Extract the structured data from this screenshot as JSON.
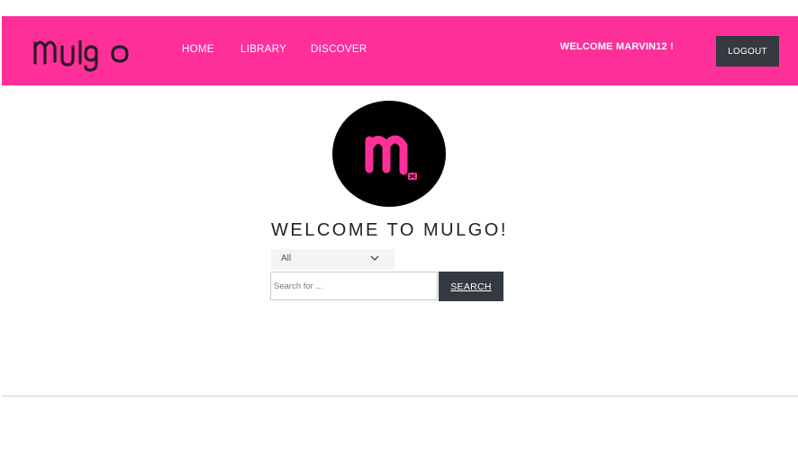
{
  "header": {
    "logo_text": "mulgo",
    "nav": [
      {
        "label": "HOME"
      },
      {
        "label": "LIBRARY"
      },
      {
        "label": "DISCOVER"
      }
    ],
    "welcome_user": "WELCOME MARVIN12 !",
    "logout_label": "LOGOUT"
  },
  "main": {
    "brand_icon": "mulgo-m-logo",
    "title": "WELCOME TO MULGO!",
    "category_select": {
      "selected": "All"
    },
    "search": {
      "placeholder": "Search for ...",
      "value": ""
    },
    "search_button_label": "SEARCH"
  },
  "colors": {
    "brand_pink": "#ff2f9a",
    "dark_button": "#343a40",
    "logo_dark": "#2c1b24"
  }
}
